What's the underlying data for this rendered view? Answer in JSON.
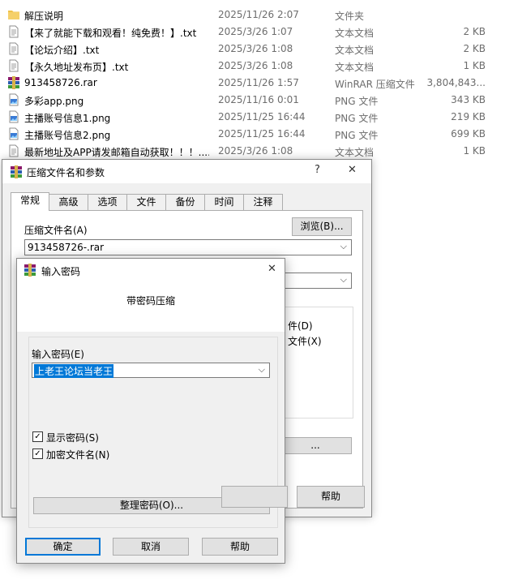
{
  "files": [
    {
      "name": "解压说明",
      "date": "2025/11/26 2:07",
      "type": "文件夹",
      "size": "",
      "icon": "folder-icon"
    },
    {
      "name": "【来了就能下载和观看！纯免费！】.txt",
      "date": "2025/3/26 1:07",
      "type": "文本文档",
      "size": "2 KB",
      "icon": "text-file-icon"
    },
    {
      "name": "【论坛介绍】.txt",
      "date": "2025/3/26 1:08",
      "type": "文本文档",
      "size": "2 KB",
      "icon": "text-file-icon"
    },
    {
      "name": "【永久地址发布页】.txt",
      "date": "2025/3/26 1:08",
      "type": "文本文档",
      "size": "1 KB",
      "icon": "text-file-icon"
    },
    {
      "name": "913458726.rar",
      "date": "2025/11/26 1:57",
      "type": "WinRAR 压缩文件",
      "size": "3,804,843...",
      "icon": "rar-archive-icon"
    },
    {
      "name": "多彩app.png",
      "date": "2025/11/16 0:01",
      "type": "PNG 文件",
      "size": "343 KB",
      "icon": "png-file-icon"
    },
    {
      "name": "主播账号信息1.png",
      "date": "2025/11/25 16:44",
      "type": "PNG 文件",
      "size": "219 KB",
      "icon": "png-file-icon"
    },
    {
      "name": "主播账号信息2.png",
      "date": "2025/11/25 16:44",
      "type": "PNG 文件",
      "size": "699 KB",
      "icon": "png-file-icon"
    },
    {
      "name": "最新地址及APP请发邮箱自动获取！！！....",
      "date": "2025/3/26 1:08",
      "type": "文本文档",
      "size": "1 KB",
      "icon": "text-file-icon"
    }
  ],
  "archive_dialog": {
    "title": "压缩文件名和参数",
    "help_glyph": "?",
    "close_glyph": "✕",
    "tabs": [
      "常规",
      "高级",
      "选项",
      "文件",
      "备份",
      "时间",
      "注释"
    ],
    "archive_name_label": "压缩文件名(A)",
    "archive_name_value": "913458726-.rar",
    "browse_label": "浏览(B)...",
    "partial_option_1": "件(D)",
    "partial_option_2": "文件(X)",
    "partial_button": "...",
    "help_label": "帮助"
  },
  "password_dialog": {
    "title": "输入密码",
    "close_glyph": "✕",
    "heading": "带密码压缩",
    "password_label": "输入密码(E)",
    "password_value": "上老王论坛当老王",
    "show_password_label": "显示密码(S)",
    "show_password_checked": true,
    "encrypt_names_label": "加密文件名(N)",
    "encrypt_names_checked": true,
    "organize_label": "整理密码(O)...",
    "ok_label": "确定",
    "cancel_label": "取消",
    "help_label": "帮助"
  },
  "colors": {
    "accent": "#0078d7",
    "selection": "#0078d7",
    "folder": "#f0c24a",
    "rar": "#8b1a6b"
  }
}
